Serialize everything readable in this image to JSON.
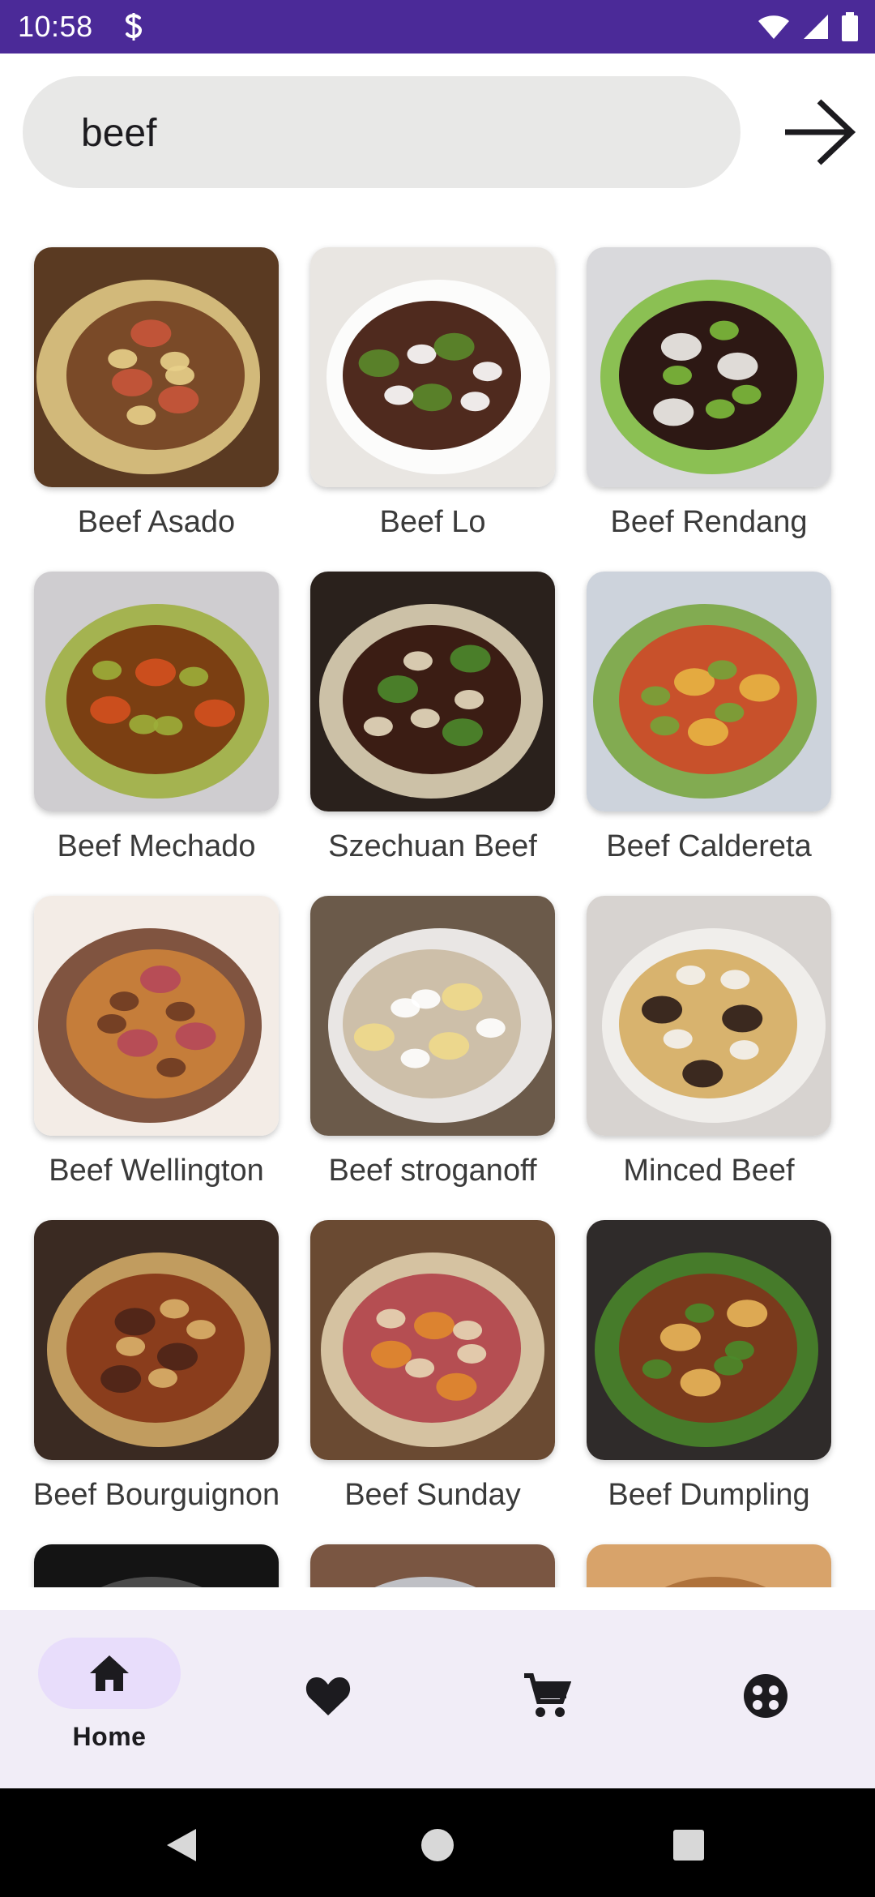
{
  "status_bar": {
    "time": "10:58"
  },
  "search": {
    "value": "beef",
    "placeholder": ""
  },
  "recipes": [
    {
      "name": "Beef Asado",
      "bg": "#5a3a22",
      "c1": "#7a4a28",
      "c2": "#c8553a",
      "c3": "#e8d08a"
    },
    {
      "name": "Beef Lo",
      "bg": "#e9e6e2",
      "c1": "#4f2a1e",
      "c2": "#5a8a2a",
      "c3": "#ffffff"
    },
    {
      "name": "Beef Rendang",
      "bg": "#d9d9dc",
      "c1": "#2d1814",
      "c2": "#f3f1ec",
      "c3": "#7dbb3b"
    },
    {
      "name": "Beef Mechado",
      "bg": "#cfcdd0",
      "c1": "#7b3f12",
      "c2": "#d4501f",
      "c3": "#9cae3a"
    },
    {
      "name": "Szechuan Beef",
      "bg": "#2a211c",
      "c1": "#3b1d14",
      "c2": "#4c8a2b",
      "c3": "#e9ddc0"
    },
    {
      "name": "Beef Caldereta",
      "bg": "#cdd3dc",
      "c1": "#c8512b",
      "c2": "#e7b442",
      "c3": "#74a338"
    },
    {
      "name": "Beef Wellington",
      "bg": "#f3ece6",
      "c1": "#c57d3a",
      "c2": "#b5485a",
      "c3": "#6b3a22"
    },
    {
      "name": "Beef stroganoff",
      "bg": "#6b5a4a",
      "c1": "#cdbfa9",
      "c2": "#f0d98a",
      "c3": "#ffffff"
    },
    {
      "name": "Minced Beef",
      "bg": "#d7d3d0",
      "c1": "#d8b36e",
      "c2": "#2a1a16",
      "c3": "#f4f2f0"
    },
    {
      "name": "Beef Bourguignon",
      "bg": "#3a2a22",
      "c1": "#8a3d1c",
      "c2": "#4b2318",
      "c3": "#d9b06a"
    },
    {
      "name": "Beef Sunday",
      "bg": "#6a4a32",
      "c1": "#b54e52",
      "c2": "#e08a2c",
      "c3": "#e7d7b5"
    },
    {
      "name": "Beef Dumpling",
      "bg": "#2f2b2a",
      "c1": "#7a3a1c",
      "c2": "#e8b65a",
      "c3": "#4a8a2a"
    },
    {
      "name": "",
      "bg": "#141414",
      "c1": "#2a2a2a",
      "c2": "#3a3a3a",
      "c3": "#555555"
    },
    {
      "name": "",
      "bg": "#7a5642",
      "c1": "#eeeeee",
      "c2": "#9d6440",
      "c3": "#cbd2dc"
    },
    {
      "name": "",
      "bg": "#d8a36a",
      "c1": "#c68a4a",
      "c2": "#e8c08a",
      "c3": "#a86a32"
    }
  ],
  "nav": {
    "home_label": "Home",
    "active_pill_color": "#e8ddfb"
  },
  "icons": {
    "signal": "signal-icon",
    "wifi": "wifi-icon",
    "battery": "battery-icon",
    "go": "arrow-right-icon",
    "home": "home-icon",
    "favorites": "heart-icon",
    "cart": "cart-icon",
    "profile": "face-icon"
  },
  "colors": {
    "status_bar": "#4b2a98",
    "nav_background": "#f1edf7",
    "search_background": "#e8e8e7"
  }
}
